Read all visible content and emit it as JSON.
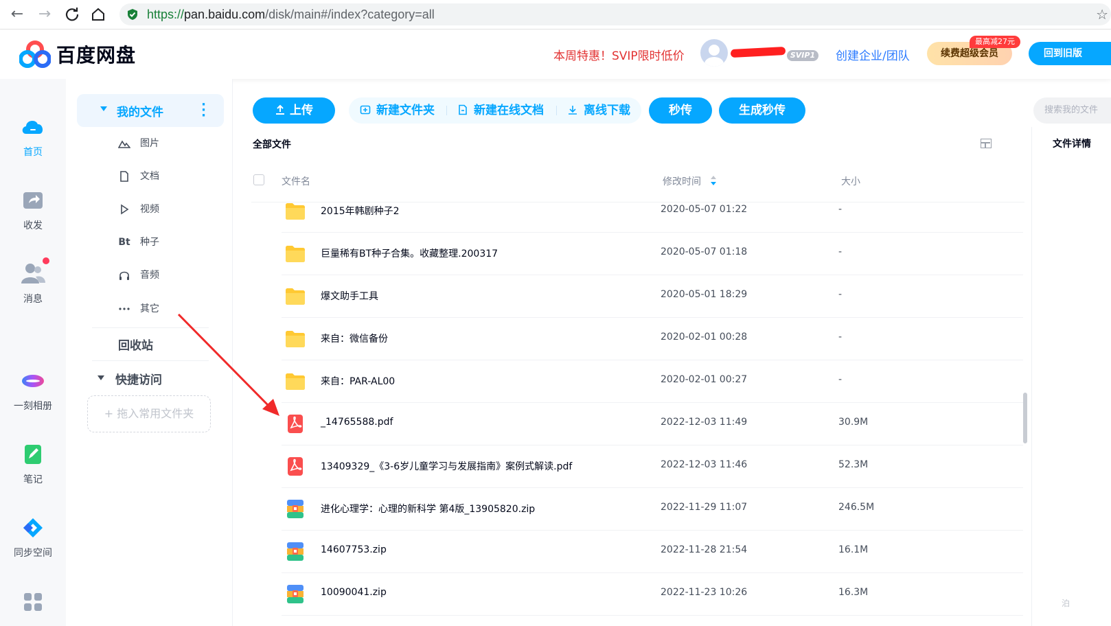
{
  "browser": {
    "url_protocol": "https://",
    "url_host": "pan.baidu.com",
    "url_path": "/disk/main#/index?category=all"
  },
  "header": {
    "logo_text": "百度网盘",
    "promo": "本周特惠！SVIP限时低价",
    "svip_badge": "SVIP1",
    "enterprise": "创建企业/团队",
    "renew_label": "续费超级会员",
    "renew_badge": "最高减27元",
    "back_old": "回到旧版"
  },
  "rail": {
    "items": [
      {
        "label": "首页",
        "icon": "cloud-icon"
      },
      {
        "label": "收发",
        "icon": "share-folder-icon"
      },
      {
        "label": "消息",
        "icon": "users-icon"
      },
      {
        "label": "一刻相册",
        "icon": "album-icon"
      },
      {
        "label": "笔记",
        "icon": "note-icon"
      },
      {
        "label": "同步空间",
        "icon": "sync-icon"
      }
    ]
  },
  "sidebar": {
    "my_files": "我的文件",
    "categories": [
      {
        "label": "图片",
        "icon": "image-icon"
      },
      {
        "label": "文档",
        "icon": "document-icon"
      },
      {
        "label": "视频",
        "icon": "video-icon"
      },
      {
        "label": "种子",
        "icon": "bt-icon",
        "glyph": "Bt"
      },
      {
        "label": "音频",
        "icon": "headphones-icon"
      },
      {
        "label": "其它",
        "icon": "more-icon"
      }
    ],
    "recycle": "回收站",
    "quick_access": "快捷访问",
    "drag_hint": "+ 拖入常用文件夹"
  },
  "toolbar": {
    "upload": "上传",
    "new_folder": "新建文件夹",
    "new_doc": "新建在线文档",
    "offline_download": "离线下载",
    "instant": "秒传",
    "gen_instant": "生成秒传",
    "search_placeholder": "搜索我的文件"
  },
  "main": {
    "breadcrumb": "全部文件",
    "detail_title": "文件详情",
    "columns": {
      "name": "文件名",
      "modified": "修改时间",
      "size": "大小"
    },
    "files": [
      {
        "name": "2015年韩剧种子2",
        "date": "2020-05-07 01:22",
        "size": "-",
        "type": "folder"
      },
      {
        "name": "巨量稀有BT种子合集。收藏整理.200317",
        "date": "2020-05-07 01:18",
        "size": "-",
        "type": "folder"
      },
      {
        "name": "爆文助手工具",
        "date": "2020-05-01 18:29",
        "size": "-",
        "type": "folder"
      },
      {
        "name": "来自：微信备份",
        "date": "2020-02-01 00:28",
        "size": "-",
        "type": "folder"
      },
      {
        "name": "来自：PAR-AL00",
        "date": "2020-02-01 00:27",
        "size": "-",
        "type": "folder"
      },
      {
        "name": "_14765588.pdf",
        "date": "2022-12-03 11:49",
        "size": "30.9M",
        "type": "pdf"
      },
      {
        "name": "13409329_《3-6岁儿童学习与发展指南》案例式解读.pdf",
        "date": "2022-12-03 11:46",
        "size": "52.3M",
        "type": "pdf"
      },
      {
        "name": "进化心理学：心理的新科学 第4版_13905820.zip",
        "date": "2022-11-29 11:07",
        "size": "246.5M",
        "type": "zip"
      },
      {
        "name": "14607753.zip",
        "date": "2022-11-28 21:54",
        "size": "16.1M",
        "type": "zip"
      },
      {
        "name": "10090041.zip",
        "date": "2022-11-23 10:26",
        "size": "16.3M",
        "type": "zip"
      }
    ],
    "corner_hint": "泊"
  },
  "colors": {
    "accent": "#06a7ff",
    "promo": "#e23232",
    "annotation_arrow": "#f02a2a"
  }
}
